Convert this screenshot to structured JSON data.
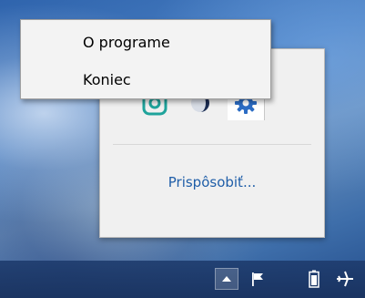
{
  "context_menu": {
    "items": [
      {
        "label": "O programe"
      },
      {
        "label": "Koniec"
      }
    ]
  },
  "tray_flyout": {
    "customize_label": "Prispôsobiť...",
    "icons": [
      "app-circle-icon",
      "half-moon-icon",
      "gear-icon"
    ]
  },
  "taskbar": {
    "icons": [
      "chevron-up-icon",
      "flag-icon",
      "battery-icon",
      "airplane-icon"
    ]
  },
  "colors": {
    "link": "#1f5ea8",
    "menu_background": "#f3f3f3",
    "flyout_background": "#f0f0f0",
    "gear_blue": "#2b6cc4"
  }
}
